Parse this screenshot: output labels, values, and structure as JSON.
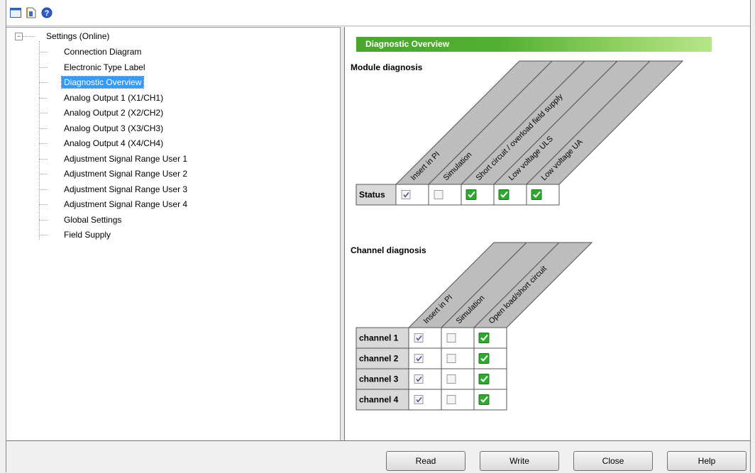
{
  "toolbar": {
    "icons": [
      "window-icon",
      "document-icon",
      "help-icon"
    ]
  },
  "tree": {
    "root_label": "Settings (Online)",
    "items": [
      {
        "label": "Connection Diagram",
        "selected": false
      },
      {
        "label": "Electronic Type Label",
        "selected": false
      },
      {
        "label": "Diagnostic Overview",
        "selected": true
      },
      {
        "label": "Analog Output 1 (X1/CH1)",
        "selected": false
      },
      {
        "label": "Analog Output 2 (X2/CH2)",
        "selected": false
      },
      {
        "label": "Analog Output 3 (X3/CH3)",
        "selected": false
      },
      {
        "label": "Analog Output 4 (X4/CH4)",
        "selected": false
      },
      {
        "label": "Adjustment Signal Range User 1",
        "selected": false
      },
      {
        "label": "Adjustment Signal Range User 2",
        "selected": false
      },
      {
        "label": "Adjustment Signal Range User 3",
        "selected": false
      },
      {
        "label": "Adjustment Signal Range User 4",
        "selected": false
      },
      {
        "label": "Global Settings",
        "selected": false
      },
      {
        "label": "Field Supply",
        "selected": false
      }
    ]
  },
  "panel": {
    "header": "Diagnostic Overview",
    "module": {
      "title": "Module diagnosis",
      "columns": [
        "Insert in PI",
        "Simulation",
        "Short circuit / overload field supply",
        "Low voltage ULS",
        "Low voltage UA"
      ],
      "rows": [
        {
          "label": "Status",
          "values": [
            "checked",
            "unchecked",
            "ok",
            "ok",
            "ok"
          ]
        }
      ]
    },
    "channel": {
      "title": "Channel diagnosis",
      "columns": [
        "Insert in PI",
        "Simulation",
        "Open load/short circuit"
      ],
      "rows": [
        {
          "label": "channel 1",
          "values": [
            "checked",
            "unchecked",
            "ok"
          ]
        },
        {
          "label": "channel 2",
          "values": [
            "checked",
            "unchecked",
            "ok"
          ]
        },
        {
          "label": "channel 3",
          "values": [
            "checked",
            "unchecked",
            "ok"
          ]
        },
        {
          "label": "channel 4",
          "values": [
            "checked",
            "unchecked",
            "ok"
          ]
        }
      ]
    }
  },
  "buttons": {
    "read": "Read",
    "write": "Write",
    "close": "Close",
    "help": "Help"
  },
  "colors": {
    "header_green": "#4aa62e",
    "ok_green": "#2fa82f",
    "selection_blue": "#3399ff",
    "column_gray": "#bdbdbd"
  }
}
